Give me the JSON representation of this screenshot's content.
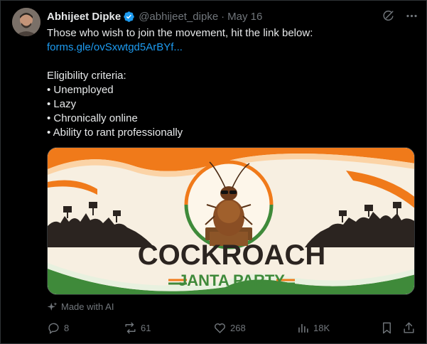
{
  "tweet": {
    "author_name": "Abhijeet Dipke",
    "handle": "@abhijeet_dipke",
    "separator": "·",
    "date": "May 16",
    "lines": [
      "Those who wish to join the movement, hit the link below:",
      "forms.gle/ovSxwtgd5ArBYf...",
      "Eligibility criteria:",
      "• Unemployed",
      "• Lazy",
      "• Chronically online",
      "• Ability to rant professionally"
    ],
    "media": {
      "title_line1": "COCKROACH",
      "title_line2": "JANTA PARTY"
    },
    "ai_label": "Made with AI",
    "stats": {
      "replies": "8",
      "reposts": "61",
      "likes": "268",
      "views": "18K"
    }
  },
  "colors": {
    "link": "#1d9bf0",
    "muted": "#71767b",
    "text": "#e7e9ea",
    "saffron": "#f07a1a",
    "green": "#3f8a3a"
  },
  "icons": [
    "verified-badge-icon",
    "grok-icon",
    "more-icon",
    "sparkle-icon",
    "reply-icon",
    "repost-icon",
    "like-icon",
    "views-icon",
    "bookmark-icon",
    "share-icon"
  ]
}
